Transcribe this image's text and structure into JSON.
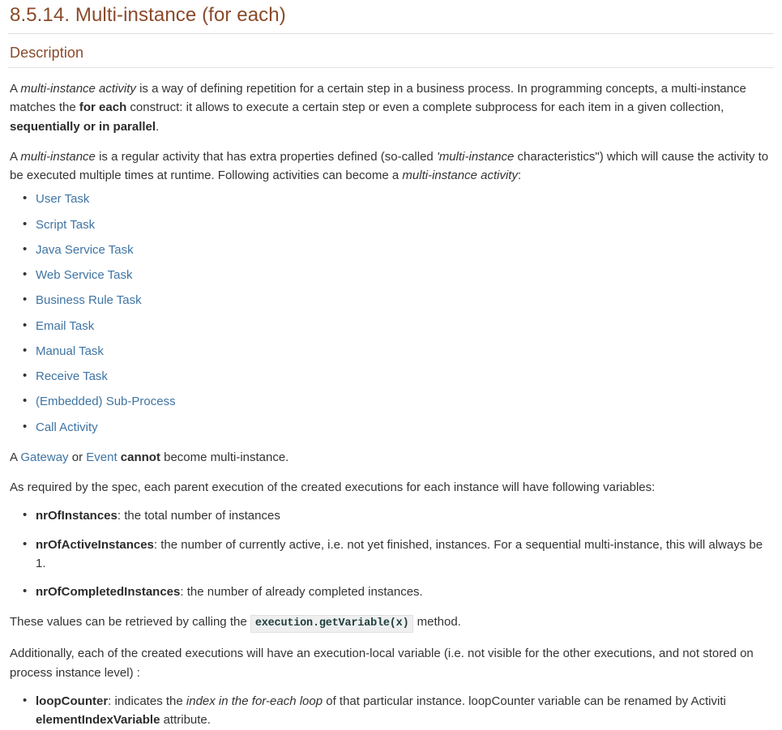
{
  "heading": {
    "title": "8.5.14. Multi-instance (for each)",
    "subtitle": "Description"
  },
  "paragraphs": {
    "p1": {
      "s1": "A ",
      "em1": "multi-instance activity",
      "s2": " is a way of defining repetition for a certain step in a business process. In programming concepts, a multi-instance matches the ",
      "b1": "for each",
      "s3": " construct: it allows to execute a certain step or even a complete subprocess for each item in a given collection, ",
      "b2": "sequentially or in parallel",
      "s4": "."
    },
    "p2": {
      "s1": "A ",
      "em1": "multi-instance",
      "s2": " is a regular activity that has extra properties defined (so-called ",
      "em2": "'multi-instance",
      "s3": " characteristics\") which will cause the activity to be executed multiple times at runtime. Following activities can become a ",
      "em3": "multi-instance activity",
      "s4": ":"
    },
    "p3": {
      "s1": "A ",
      "link1": "Gateway",
      "s2": " or ",
      "link2": "Event",
      "s3": " ",
      "b1": "cannot",
      "s4": " become multi-instance."
    },
    "p4": "As required by the spec, each parent execution of the created executions for each instance will have following variables:",
    "p5": {
      "s1": "These values can be retrieved by calling the ",
      "code": "execution.getVariable(x)",
      "s2": " method."
    },
    "p6": "Additionally, each of the created executions will have an execution-local variable (i.e. not visible for the other executions, and not stored on process instance level) :"
  },
  "activity_links": [
    {
      "label": "User Task"
    },
    {
      "label": "Script Task"
    },
    {
      "label": "Java Service Task"
    },
    {
      "label": "Web Service Task"
    },
    {
      "label": "Business Rule Task"
    },
    {
      "label": "Email Task"
    },
    {
      "label": "Manual Task"
    },
    {
      "label": "Receive Task"
    },
    {
      "label": "(Embedded) Sub-Process"
    },
    {
      "label": "Call Activity"
    }
  ],
  "variables": [
    {
      "name": "nrOfInstances",
      "desc": ": the total number of instances"
    },
    {
      "name": "nrOfActiveInstances",
      "desc": ": the number of currently active, i.e. not yet finished, instances. For a sequential multi-instance, this will always be 1."
    },
    {
      "name": "nrOfCompletedInstances",
      "desc": ": the number of already completed instances."
    }
  ],
  "local_variable": {
    "name": "loopCounter",
    "part1": ": indicates the ",
    "em1": "index in the for-each loop",
    "part2": " of that particular instance. loopCounter variable can be renamed by Activiti ",
    "b1": "elementIndexVariable",
    "part3": " attribute."
  },
  "colors": {
    "heading": "#8a4a2a",
    "link": "#3f74a3",
    "text": "#333333",
    "rule": "#dddddd",
    "code_bg": "#efefef"
  }
}
